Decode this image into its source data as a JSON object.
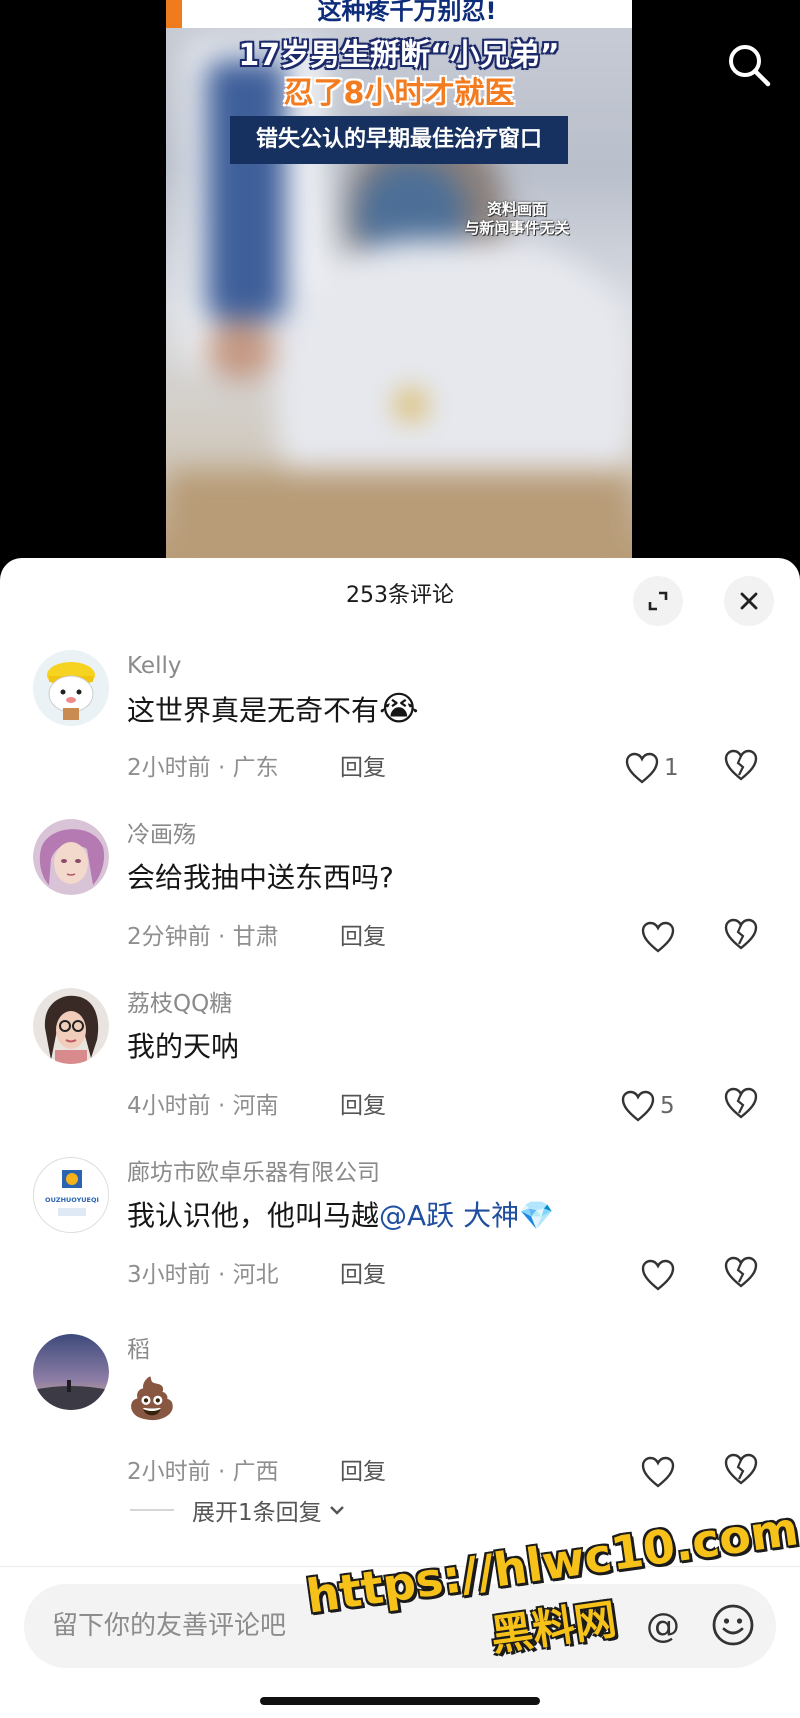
{
  "video": {
    "headline_top": "这种疼千万别忍!",
    "headline_line1": "17岁男生掰断“小兄弟”",
    "headline_line2": "忍了8小时才就医",
    "headline_box": "错失公认的早期最佳治疗窗口",
    "disclaimer_line1": "资料画面",
    "disclaimer_line2": "与新闻事件无关",
    "search_icon": "search-icon"
  },
  "sheet": {
    "title": "253条评论",
    "expand_icon": "expand-icon",
    "close_icon": "close-icon"
  },
  "comments": [
    {
      "username": "Kelly",
      "text": "这世界真是无奇不有",
      "emoji": "😭",
      "meta": "2小时前 · 广东",
      "reply": "回复",
      "likes": "1"
    },
    {
      "username": "冷画殇",
      "text": "会给我抽中送东西吗?",
      "meta": "2分钟前 · 甘肃",
      "reply": "回复",
      "likes": ""
    },
    {
      "username": "荔枝QQ糖",
      "text": "我的天呐",
      "meta": "4小时前 · 河南",
      "reply": "回复",
      "likes": "5"
    },
    {
      "username": "廊坊市欧卓乐器有限公司",
      "text": "我认识他，他叫马越",
      "mention": "@A跃 大神",
      "emoji": "💎",
      "meta": "3小时前 · 河北",
      "reply": "回复",
      "likes": "",
      "avatar_text": "OUZHUOYUEQI"
    },
    {
      "username": "稻",
      "text": "",
      "emoji": "💩",
      "meta": "2小时前 · 广西",
      "reply": "回复",
      "likes": ""
    }
  ],
  "expand_replies": "展开1条回复",
  "input": {
    "placeholder": "留下你的友善评论吧",
    "at_label": "@",
    "emoji_icon": "emoji-icon"
  },
  "watermark": {
    "line1": "https://hlwc10.com",
    "line2": "黑料网"
  },
  "colors": {
    "accent_orange": "#f27c1f",
    "mention_blue": "#1f4f9e",
    "watermark_yellow": "#f6c21a"
  }
}
